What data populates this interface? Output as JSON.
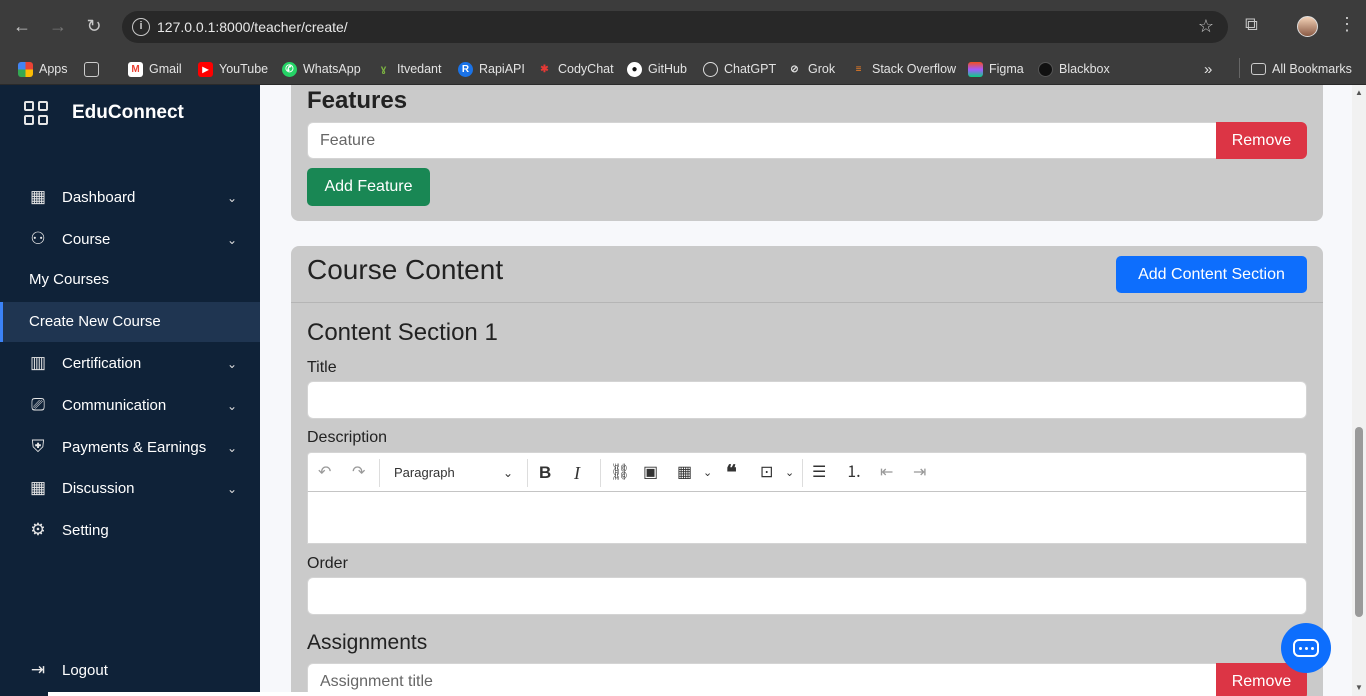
{
  "browser": {
    "url": "127.0.0.1:8000/teacher/create/",
    "bookmarks": [
      {
        "label": "Apps",
        "icon": "apps-grid-icon",
        "color": "#f28b82"
      },
      {
        "label": "",
        "icon": "tab-groups-icon",
        "color": "#cccccc"
      },
      {
        "label": "Gmail",
        "icon": "gmail-icon",
        "color": "#ea4335"
      },
      {
        "label": "YouTube",
        "icon": "youtube-icon",
        "color": "#ff0000"
      },
      {
        "label": "WhatsApp",
        "icon": "whatsapp-icon",
        "color": "#25d366"
      },
      {
        "label": "Itvedant",
        "icon": "itvedant-icon",
        "color": "#7cb342"
      },
      {
        "label": "RapiAPI",
        "icon": "rapidapi-icon",
        "color": "#1a73e8"
      },
      {
        "label": "CodyChat",
        "icon": "codychat-icon",
        "color": "#e53935"
      },
      {
        "label": "GitHub",
        "icon": "github-icon",
        "color": "#ffffff"
      },
      {
        "label": "ChatGPT",
        "icon": "chatgpt-icon",
        "color": "#ffffff"
      },
      {
        "label": "Grok",
        "icon": "grok-icon",
        "color": "#ffffff"
      },
      {
        "label": "Stack Overflow",
        "icon": "stackoverflow-icon",
        "color": "#f48024"
      },
      {
        "label": "Figma",
        "icon": "figma-icon",
        "color": "#f24e1e"
      },
      {
        "label": "Blackbox",
        "icon": "blackbox-icon",
        "color": "#111111"
      }
    ],
    "all_bookmarks": "All Bookmarks"
  },
  "sidebar": {
    "brand": "EduConnect",
    "items": [
      {
        "label": "Dashboard",
        "icon": "table-icon",
        "has_chevron": true
      },
      {
        "label": "Course",
        "icon": "user-icon",
        "has_chevron": true
      },
      {
        "label": "My Courses",
        "icon": "",
        "sub": true
      },
      {
        "label": "Create New Course",
        "icon": "",
        "sub": true,
        "active": true
      },
      {
        "label": "Certification",
        "icon": "building-icon",
        "has_chevron": true
      },
      {
        "label": "Communication",
        "icon": "camera-icon",
        "has_chevron": true
      },
      {
        "label": "Payments & Earnings",
        "icon": "shield-icon",
        "has_chevron": true
      },
      {
        "label": "Discussion",
        "icon": "table-icon",
        "has_chevron": true
      },
      {
        "label": "Setting",
        "icon": "gear-icon",
        "has_chevron": false
      }
    ],
    "logout": "Logout"
  },
  "features": {
    "title": "Features",
    "feature_placeholder": "Feature",
    "remove_label": "Remove",
    "add_feature_label": "Add Feature"
  },
  "content": {
    "title": "Course Content",
    "add_section_label": "Add Content Section",
    "section_title": "Content Section 1",
    "title_label": "Title",
    "description_label": "Description",
    "paragraph_select": "Paragraph",
    "order_label": "Order",
    "assignments_title": "Assignments",
    "assignment_placeholder": "Assignment title",
    "assignment_remove_label": "Remove"
  },
  "colors": {
    "sidebar_bg": "#0f2238",
    "card_bg": "#cacaca",
    "danger": "#dc3545",
    "success": "#198754",
    "primary": "#0d6efd"
  }
}
